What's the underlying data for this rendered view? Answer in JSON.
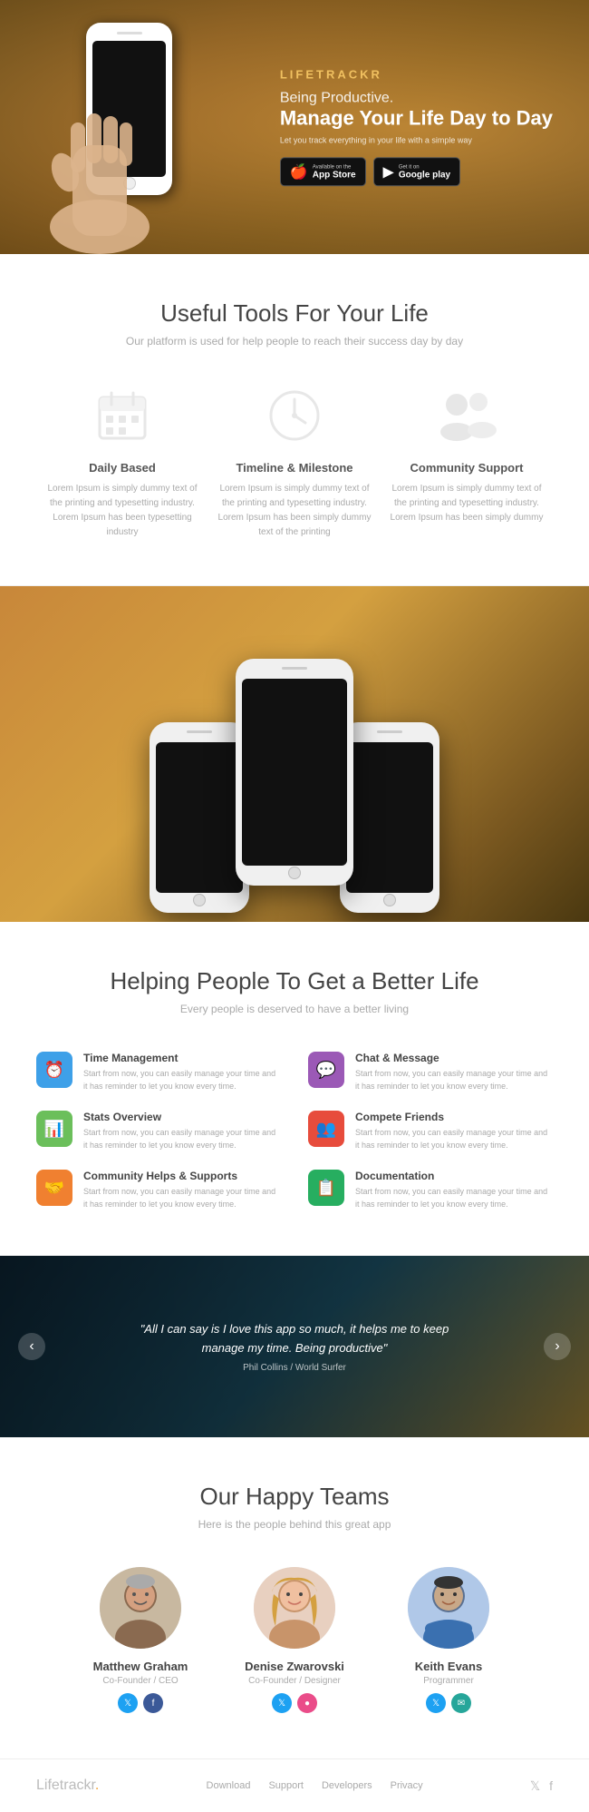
{
  "brand": {
    "name": "LIFETRACKR",
    "logo_text": "Lifetrackr.",
    "dot_color": "#f0a030"
  },
  "hero": {
    "tagline1": "Being Productive.",
    "tagline2": "Manage Your Life Day to Day",
    "sub": "Let you track everything in your life with a simple way",
    "appstore_label_top": "Available on the",
    "appstore_label_main": "App Store",
    "googleplay_label_top": "Get it on",
    "googleplay_label_main": "Google play"
  },
  "tools": {
    "section_title": "Useful Tools For Your Life",
    "section_subtitle": "Our platform is used for help people to reach their success day by day",
    "features": [
      {
        "id": "daily-based",
        "title": "Daily Based",
        "desc": "Lorem Ipsum is simply dummy text of the printing and typesetting industry. Lorem Ipsum has been typesetting industry"
      },
      {
        "id": "timeline-milestone",
        "title": "Timeline & Milestone",
        "desc": "Lorem Ipsum is simply dummy text of the printing and typesetting industry. Lorem Ipsum has been simply dummy text of the printing"
      },
      {
        "id": "community-support",
        "title": "Community Support",
        "desc": "Lorem Ipsum is simply dummy text of the printing and typesetting industry. Lorem Ipsum has been simply dummy"
      }
    ]
  },
  "better_life": {
    "section_title": "Helping People To Get a Better Life",
    "section_subtitle": "Every people is deserved to have a better living",
    "features_left": [
      {
        "id": "time-management",
        "title": "Time Management",
        "desc": "Start from now, you can easily manage your time and it has reminder to let you know every time.",
        "icon_color": "#3ea0e8",
        "icon": "⏰"
      },
      {
        "id": "stats-overview",
        "title": "Stats Overview",
        "desc": "Start from now, you can easily manage your time and it has reminder to let you know every time.",
        "icon_color": "#6bbf5b",
        "icon": "📊"
      },
      {
        "id": "community-helps",
        "title": "Community Helps & Supports",
        "desc": "Start from now, you can easily manage your time and it has reminder to let you know every time.",
        "icon_color": "#f08030",
        "icon": "🤝"
      }
    ],
    "features_right": [
      {
        "id": "chat-message",
        "title": "Chat & Message",
        "desc": "Start from now, you can easily manage your time and it has reminder to let you know every time.",
        "icon_color": "#9b59b6",
        "icon": "💬"
      },
      {
        "id": "compete-friends",
        "title": "Compete Friends",
        "desc": "Start from now, you can easily manage your time and it has reminder to let you know every time.",
        "icon_color": "#e74c3c",
        "icon": "👥"
      },
      {
        "id": "documentation",
        "title": "Documentation",
        "desc": "Start from now, you can easily manage your time and it has reminder to let you know every time.",
        "icon_color": "#27ae60",
        "icon": "📋"
      }
    ]
  },
  "testimonial": {
    "quote": "\"All I can say is I love this app so much, it helps me to keep manage my time. Being productive\"",
    "author": "Phil Collins / World Surfer",
    "nav_prev": "‹",
    "nav_next": "›"
  },
  "team": {
    "section_title": "Our Happy Teams",
    "section_subtitle": "Here is the people behind this great app",
    "members": [
      {
        "name": "Matthew Graham",
        "role": "Co-Founder / CEO",
        "socials": [
          "twitter",
          "facebook"
        ]
      },
      {
        "name": "Denise Zwarovski",
        "role": "Co-Founder / Designer",
        "socials": [
          "twitter",
          "dribbble"
        ]
      },
      {
        "name": "Keith Evans",
        "role": "Programmer",
        "socials": [
          "twitter",
          "envelope"
        ]
      }
    ]
  },
  "footer": {
    "logo": "Lifetrackr.",
    "links": [
      "Download",
      "Support",
      "Developers",
      "Privacy"
    ],
    "socials": [
      "twitter",
      "facebook"
    ]
  }
}
